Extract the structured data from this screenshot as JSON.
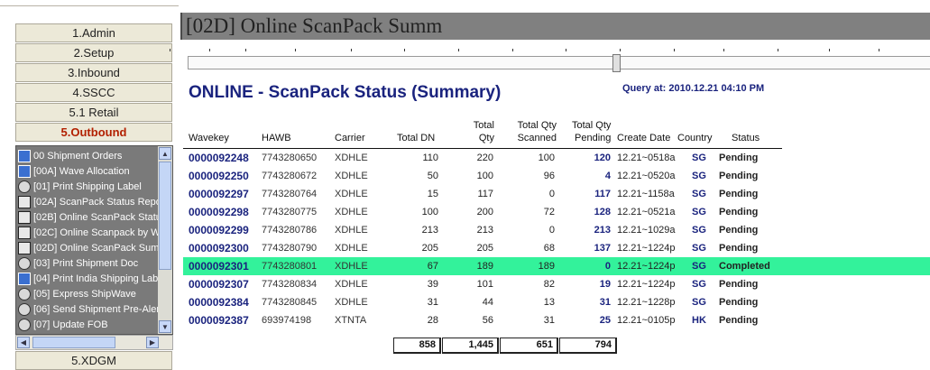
{
  "nav": {
    "buttons": [
      "1.Admin",
      "2.Setup",
      "3.Inbound",
      "4.SSCC",
      "5.1 Retail",
      "5.Outbound"
    ],
    "active": "5.Outbound",
    "tree_items": [
      {
        "label": "00 Shipment Orders",
        "icon": "orders-icon"
      },
      {
        "label": "[00A]  Wave Allocation",
        "icon": "wave-icon"
      },
      {
        "label": "[01] Print Shipping Label",
        "icon": "search-report-icon"
      },
      {
        "label": "[02A] ScanPack Status Repo",
        "icon": "report-grid-icon"
      },
      {
        "label": "[02B] Online ScanPack Statu",
        "icon": "report-grid-icon"
      },
      {
        "label": "[02C] Online Scanpack by W",
        "icon": "report-grid-icon"
      },
      {
        "label": "[02D] Online ScanPack Summ",
        "icon": "report-grid-icon"
      },
      {
        "label": "[03] Print Shipment Doc",
        "icon": "search-report-icon"
      },
      {
        "label": "[04] Print India Shipping Labe",
        "icon": "orders-icon"
      },
      {
        "label": "[05] Express ShipWave",
        "icon": "search-report-icon"
      },
      {
        "label": "[06] Send Shipment Pre-Aler",
        "icon": "search-report-icon"
      },
      {
        "label": "[07] Update FOB",
        "icon": "search-report-icon"
      }
    ],
    "bottom_button": "5.XDGM"
  },
  "window": {
    "title": "[02D] Online ScanPack Summ"
  },
  "report": {
    "title": "ONLINE - ScanPack Status (Summary)",
    "query_at": "Query at:  2010.12.21 04:10 PM",
    "headers": {
      "wavekey": "Wavekey",
      "hawb": "HAWB",
      "carrier": "Carrier",
      "total_dn": "Total DN",
      "total_qty_1": "Total",
      "total_qty_2": "Qty",
      "scanned_1": "Total Qty",
      "scanned_2": "Scanned",
      "pending_1": "Total Qty",
      "pending_2": "Pending",
      "create_date": "Create Date",
      "country": "Country",
      "status": "Status"
    },
    "rows": [
      {
        "wavekey": "0000092248",
        "hawb": "7743280650",
        "carrier": "XDHLE",
        "total_dn": "110",
        "total_qty": "220",
        "scanned": "100",
        "pending": "120",
        "date": "12.21~0518a",
        "country": "SG",
        "status": "Pending"
      },
      {
        "wavekey": "0000092250",
        "hawb": "7743280672",
        "carrier": "XDHLE",
        "total_dn": "50",
        "total_qty": "100",
        "scanned": "96",
        "pending": "4",
        "date": "12.21~0520a",
        "country": "SG",
        "status": "Pending"
      },
      {
        "wavekey": "0000092297",
        "hawb": "7743280764",
        "carrier": "XDHLE",
        "total_dn": "15",
        "total_qty": "117",
        "scanned": "0",
        "pending": "117",
        "date": "12.21~1158a",
        "country": "SG",
        "status": "Pending"
      },
      {
        "wavekey": "0000092298",
        "hawb": "7743280775",
        "carrier": "XDHLE",
        "total_dn": "100",
        "total_qty": "200",
        "scanned": "72",
        "pending": "128",
        "date": "12.21~0521a",
        "country": "SG",
        "status": "Pending"
      },
      {
        "wavekey": "0000092299",
        "hawb": "7743280786",
        "carrier": "XDHLE",
        "total_dn": "213",
        "total_qty": "213",
        "scanned": "0",
        "pending": "213",
        "date": "12.21~1029a",
        "country": "SG",
        "status": "Pending"
      },
      {
        "wavekey": "0000092300",
        "hawb": "7743280790",
        "carrier": "XDHLE",
        "total_dn": "205",
        "total_qty": "205",
        "scanned": "68",
        "pending": "137",
        "date": "12.21~1224p",
        "country": "SG",
        "status": "Pending"
      },
      {
        "wavekey": "0000092301",
        "hawb": "7743280801",
        "carrier": "XDHLE",
        "total_dn": "67",
        "total_qty": "189",
        "scanned": "189",
        "pending": "0",
        "date": "12.21~1224p",
        "country": "SG",
        "status": "Completed"
      },
      {
        "wavekey": "0000092307",
        "hawb": "7743280834",
        "carrier": "XDHLE",
        "total_dn": "39",
        "total_qty": "101",
        "scanned": "82",
        "pending": "19",
        "date": "12.21~1224p",
        "country": "SG",
        "status": "Pending"
      },
      {
        "wavekey": "0000092384",
        "hawb": "7743280845",
        "carrier": "XDHLE",
        "total_dn": "31",
        "total_qty": "44",
        "scanned": "13",
        "pending": "31",
        "date": "12.21~1228p",
        "country": "SG",
        "status": "Pending"
      },
      {
        "wavekey": "0000092387",
        "hawb": "693974198",
        "carrier": "XTNTA",
        "total_dn": "28",
        "total_qty": "56",
        "scanned": "31",
        "pending": "25",
        "date": "12.21~0105p",
        "country": "HK",
        "status": "Pending"
      }
    ],
    "totals": {
      "total_dn": "858",
      "total_qty": "1,445",
      "scanned": "651",
      "pending": "794"
    },
    "highlight_color": "#33f29b"
  }
}
